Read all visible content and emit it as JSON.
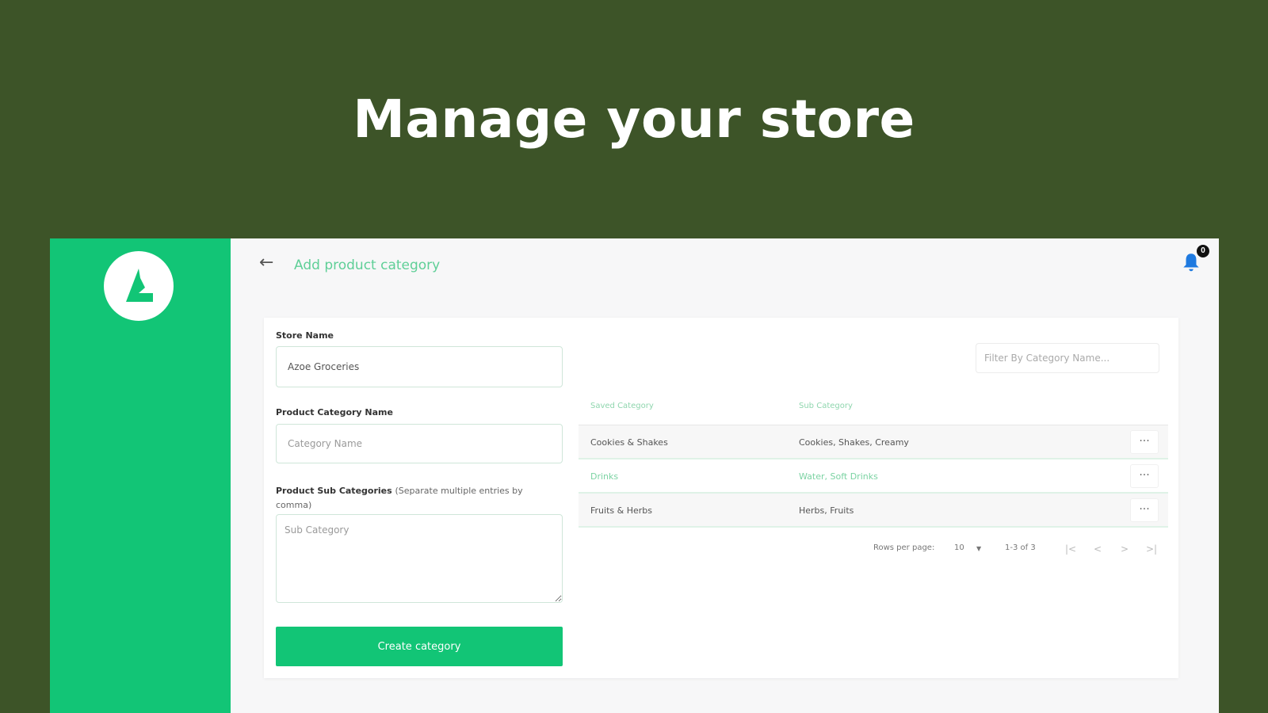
{
  "headline": "Manage your store",
  "header": {
    "back_icon": "arrow-left-icon",
    "title": "Add product category",
    "notification_count": "0"
  },
  "form": {
    "store_name_label": "Store Name",
    "store_name_value": "Azoe Groceries",
    "category_name_label": "Product Category Name",
    "category_name_placeholder": "Category Name",
    "sub_categories_label": "Product Sub Categories",
    "sub_categories_hint": "(Separate multiple entries by comma)",
    "sub_categories_placeholder": "Sub Category",
    "create_button": "Create category"
  },
  "filter": {
    "placeholder": "Filter By Category Name..."
  },
  "table": {
    "headers": [
      "Saved Category",
      "Sub Category"
    ],
    "rows": [
      {
        "category": "Cookies & Shakes",
        "sub": "Cookies, Shakes, Creamy"
      },
      {
        "category": "Drinks",
        "sub": "Water, Soft Drinks"
      },
      {
        "category": "Fruits & Herbs",
        "sub": "Herbs, Fruits"
      }
    ],
    "more_label": "···"
  },
  "pagination": {
    "rows_per_page_label": "Rows per page:",
    "rows_per_page_value": "10",
    "range": "1-3 of 3",
    "first": "|<",
    "prev": "<",
    "next": ">",
    "last": ">|"
  },
  "colors": {
    "background": "#3d5428",
    "brand": "#12c576",
    "accent_text": "#5fcf97",
    "bell": "#1f7ae0"
  }
}
